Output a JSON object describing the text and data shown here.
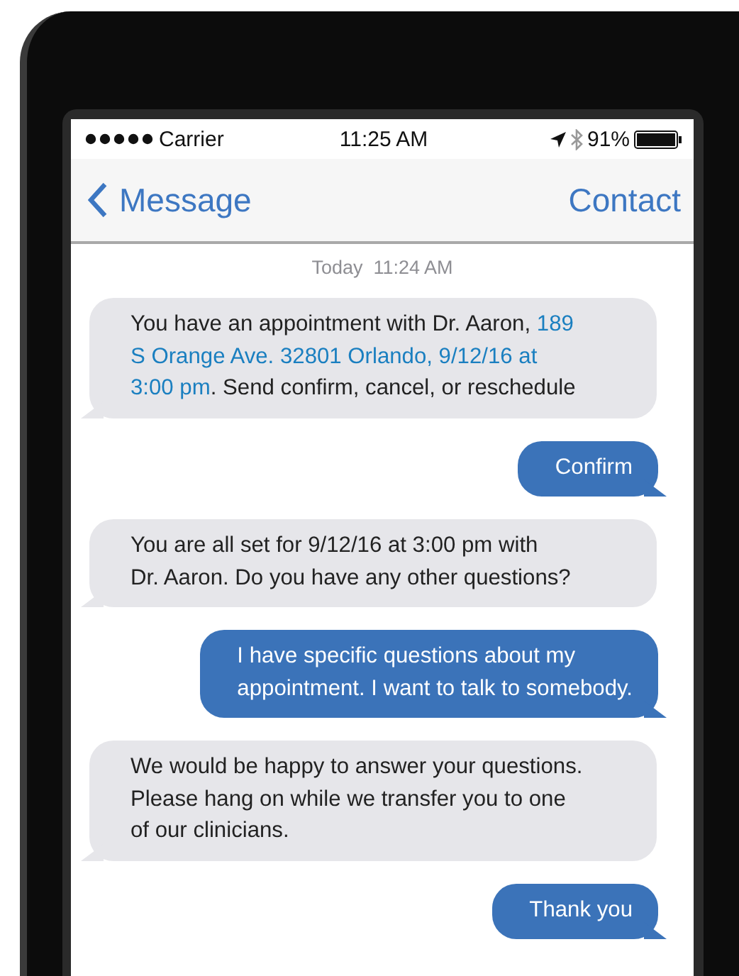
{
  "status_bar": {
    "carrier": "Carrier",
    "time": "11:25 AM",
    "battery": "91%"
  },
  "nav": {
    "back": "Message",
    "action": "Contact"
  },
  "timestamp": {
    "day": "Today",
    "time": "11:24 AM"
  },
  "messages": [
    {
      "kind": "incoming",
      "lines": [
        [
          {
            "kind": "text",
            "text": "You have an appointment with Dr. Aaron,"
          },
          {
            "kind": "link",
            "text": "189"
          }
        ],
        [
          {
            "kind": "link",
            "text": "S Orange Ave. 32801 Orlando, 9/12/16 at"
          }
        ],
        [
          {
            "kind": "link",
            "text": "3:00 pm"
          },
          {
            "kind": "text",
            "text": ". Send confirm, cancel, or reschedule"
          }
        ]
      ]
    },
    {
      "kind": "outgoing",
      "lines": [
        [
          {
            "kind": "text",
            "text": "Confirm"
          }
        ]
      ]
    },
    {
      "kind": "incoming",
      "lines": [
        [
          {
            "kind": "text",
            "text": "You are all set for 9/12/16 at 3:00 pm with"
          }
        ],
        [
          {
            "kind": "text",
            "text": "Dr. Aaron. Do you have any other questions?"
          }
        ]
      ]
    },
    {
      "kind": "outgoing",
      "lines": [
        [
          {
            "kind": "text",
            "text": "I have specific questions about my"
          }
        ],
        [
          {
            "kind": "text",
            "text": "appointment. I want to talk to somebody."
          }
        ]
      ]
    },
    {
      "kind": "incoming",
      "lines": [
        [
          {
            "kind": "text",
            "text": "We would be happy to answer your questions."
          }
        ],
        [
          {
            "kind": "text",
            "text": "Please hang on while we transfer you to one"
          }
        ],
        [
          {
            "kind": "text",
            "text": "of our clinicians."
          }
        ]
      ]
    },
    {
      "kind": "outgoing",
      "lines": [
        [
          {
            "kind": "text",
            "text": "Thank you"
          }
        ]
      ]
    }
  ]
}
